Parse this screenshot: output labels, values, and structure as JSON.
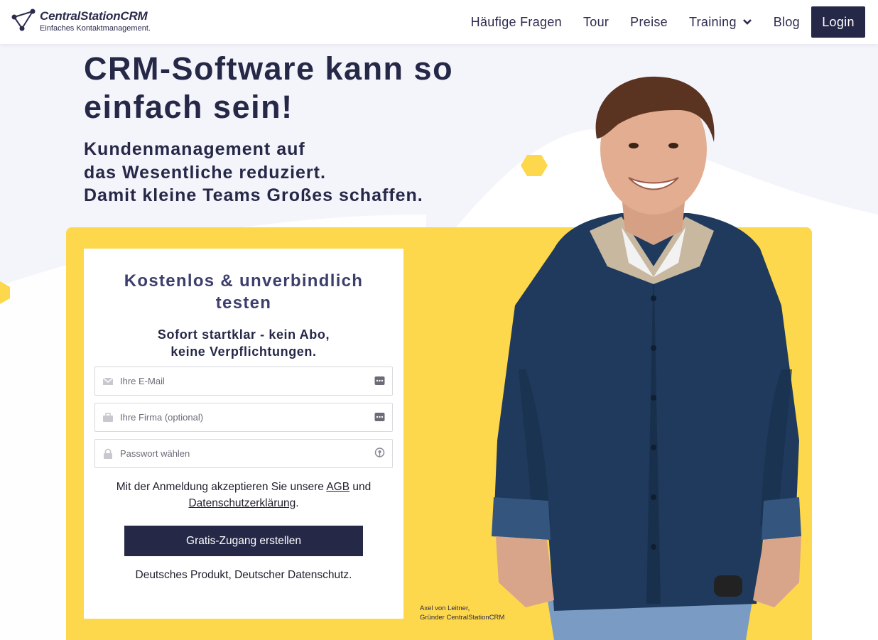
{
  "brand": {
    "name": "CentralStationCRM",
    "tagline": "Einfaches Kontaktmanagement."
  },
  "nav": {
    "items": [
      {
        "label": "Häufige Fragen"
      },
      {
        "label": "Tour"
      },
      {
        "label": "Preise"
      },
      {
        "label": "Training"
      },
      {
        "label": "Blog"
      }
    ],
    "login_label": "Login"
  },
  "hero": {
    "title": "CRM-Software kann so einfach sein!",
    "subtitle_lines": [
      "Kundenmanagement auf",
      "das Wesentliche reduziert.",
      "Damit kleine Teams Großes schaffen."
    ]
  },
  "form": {
    "title": "Kostenlos & unverbindlich testen",
    "subtitle_lines": [
      "Sofort startklar - kein Abo,",
      "keine Verpflichtungen."
    ],
    "email_placeholder": "Ihre E-Mail",
    "company_placeholder": "Ihre Firma (optional)",
    "password_placeholder": "Passwort wählen",
    "terms_prefix": "Mit der Anmeldung akzeptieren Sie unsere",
    "terms_agb": "AGB",
    "terms_and": "und",
    "terms_privacy": "Datenschutzerklärung",
    "terms_period": ".",
    "cta_label": "Gratis-Zugang erstellen",
    "footer_note": "Deutsches Produkt, Deutscher Datenschutz."
  },
  "caption": {
    "line1": "Axel von Leitner,",
    "line2": "Gründer CentralStationCRM"
  },
  "colors": {
    "navy": "#262848",
    "yellow": "#fdd74c",
    "background": "#f4f4fb"
  }
}
